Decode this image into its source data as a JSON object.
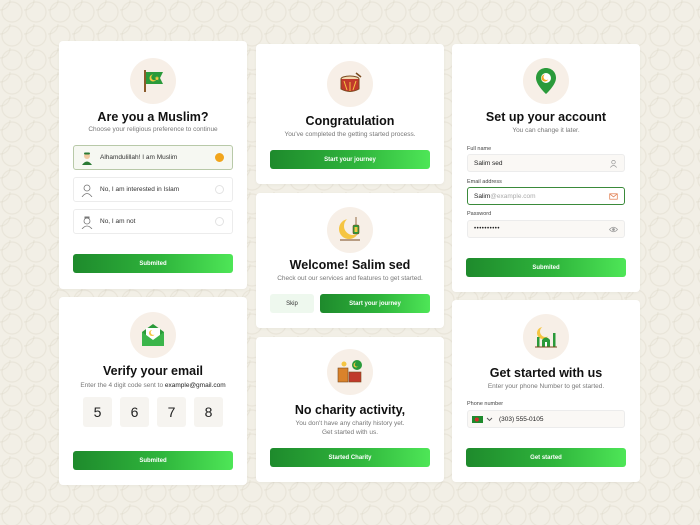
{
  "colors": {
    "accent_green": "#2fb53c",
    "radio_selected": "#f1a51c",
    "focus_border": "#3a8a3a"
  },
  "muslim_card": {
    "icon": "flag-crescent-icon",
    "title": "Are you a Muslim?",
    "subtitle": "Choose your religious preference to continue",
    "options": [
      {
        "label": "Alhamdulillah!  I am Muslim",
        "avatar": "muslim-man-avatar-icon",
        "selected": true
      },
      {
        "label": "No, I am interested in Islam",
        "avatar": "man-avatar-icon",
        "selected": false
      },
      {
        "label": "No, I am not",
        "avatar": "man-cap-avatar-icon",
        "selected": false
      }
    ],
    "button": "Submited"
  },
  "congrats_card": {
    "icon": "drum-icon",
    "title": "Congratulation",
    "subtitle": "You've completed the getting started process.",
    "button": "Start your journey"
  },
  "account_card": {
    "icon": "location-pin-icon",
    "title": "Set up your account",
    "subtitle": "You can change it later.",
    "full_name_label": "Full name",
    "full_name_value": "Salim sed",
    "email_label": "Email address",
    "email_value": "Salim",
    "email_placeholder": "@example.com",
    "password_label": "Password",
    "password_value": "••••••••••",
    "button": "Submited"
  },
  "welcome_card": {
    "icon": "crescent-lantern-icon",
    "title": "Welcome! Salim sed",
    "subtitle": "Check out our services and features to get started.",
    "skip": "Skip",
    "button": "Start your journey"
  },
  "verify_card": {
    "icon": "envelope-icon",
    "title": "Verify your email",
    "subtitle_prefix": "Enter the 4 digit code sent to ",
    "email": "example@gmail.com",
    "digits": [
      "5",
      "6",
      "7",
      "8"
    ],
    "button": "Submited"
  },
  "charity_card": {
    "icon": "charity-box-icon",
    "title": "No charity activity,",
    "subtitle_line1": "You don't have any charity history yet.",
    "subtitle_line2": "Get started with us.",
    "button": "Started Charity"
  },
  "phone_card": {
    "icon": "mosque-icon",
    "title": "Get started with us",
    "subtitle": "Enter your phone Number to get started.",
    "phone_label": "Phone number",
    "phone_value": "(303) 555-0105",
    "button": "Get started"
  }
}
